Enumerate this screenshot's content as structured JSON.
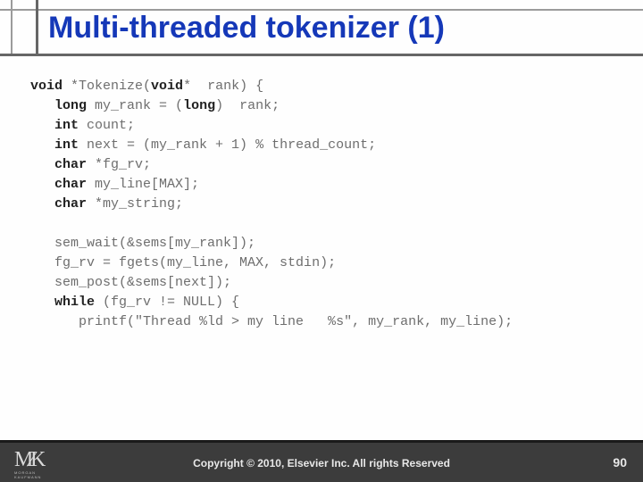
{
  "title": "Multi-threaded tokenizer (1)",
  "code": {
    "l1a": "void",
    "l1b": " *Tokenize(",
    "l1c": "void",
    "l1d": "*  rank) {",
    "l2a": "long",
    "l2b": " my_rank = (",
    "l2c": "long",
    "l2d": ")  rank;",
    "l3a": "int",
    "l3b": " count;",
    "l4a": "int",
    "l4b": " next = (my_rank + 1) % thread_count;",
    "l5a": "char",
    "l5b": " *fg_rv;",
    "l6a": "char",
    "l6b": " my_line[MAX];",
    "l7a": "char",
    "l7b": " *my_string;",
    "l8": "sem_wait(&sems[my_rank]);",
    "l9": "fg_rv = fgets(my_line, MAX, stdin);",
    "l10": "sem_post(&sems[next]);",
    "l11a": "while",
    "l11b": " (fg_rv != NULL) {",
    "l12": "printf(\"Thread %ld > my line   %s\", my_rank, my_line);"
  },
  "footer": {
    "copyright": "Copyright © 2010, Elsevier Inc. All rights Reserved",
    "page": "90",
    "logo_main": "M/K",
    "logo_sub": "MORGAN KAUFMANN"
  }
}
